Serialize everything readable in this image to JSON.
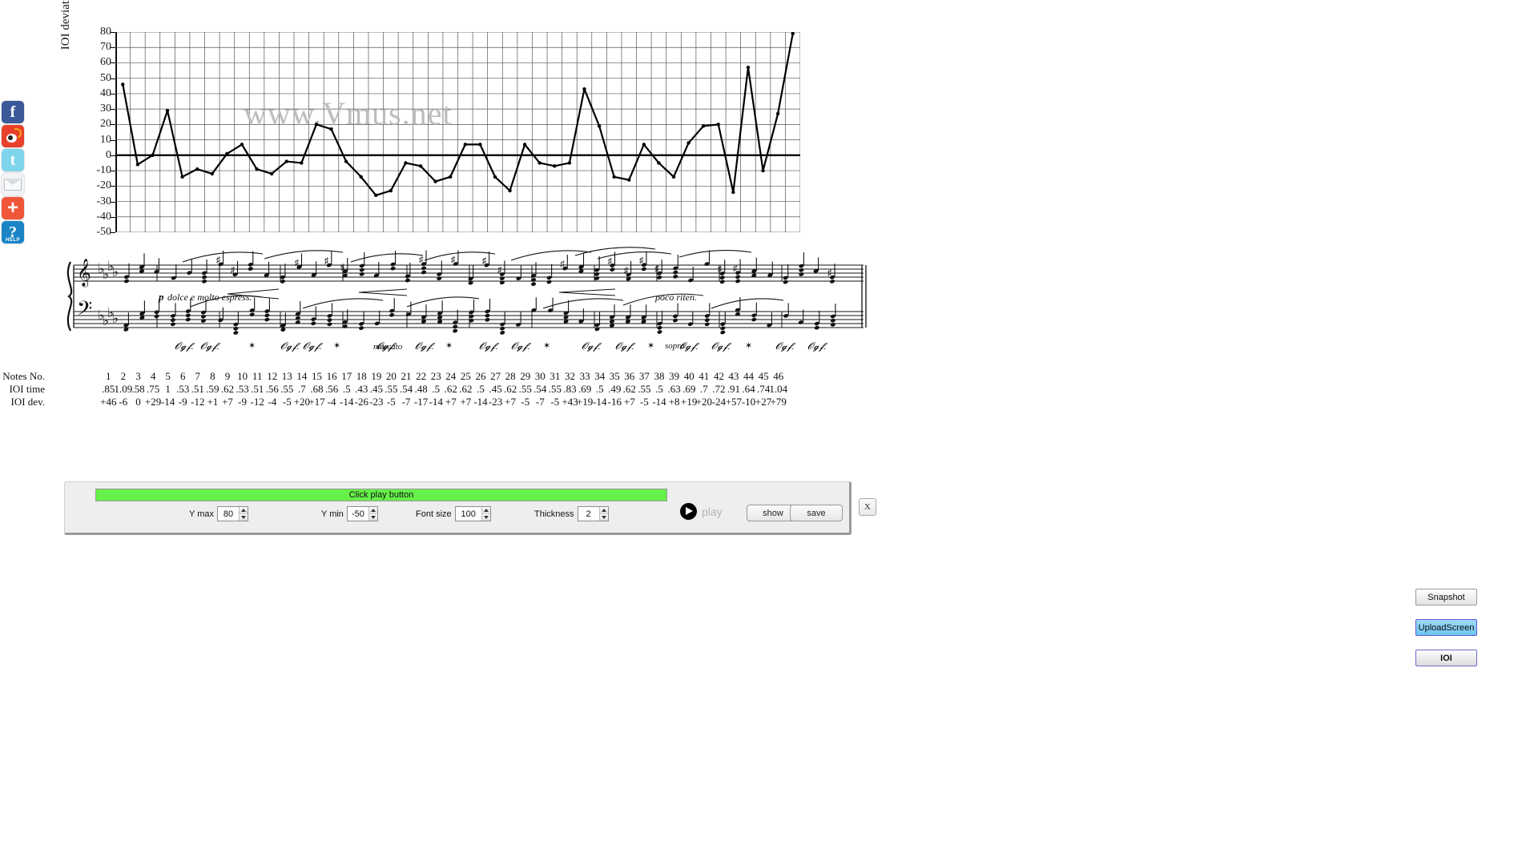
{
  "social_rail": {
    "items": [
      {
        "name": "facebook-icon",
        "label": "f",
        "color": "#3b5998"
      },
      {
        "name": "weibo-icon",
        "label": "",
        "color": "#e8402a"
      },
      {
        "name": "twitter-icon",
        "label": "t",
        "color": "#7ed4ea"
      },
      {
        "name": "email-icon",
        "label": "",
        "color": "#f2f3f5"
      },
      {
        "name": "share-plus-icon",
        "label": "+",
        "color": "#f0563a"
      },
      {
        "name": "help-icon",
        "label": "?",
        "sublabel": "HELP",
        "color": "#1a84c6"
      }
    ]
  },
  "watermark": "www.Vmus.net",
  "chart_data": {
    "type": "line",
    "title": "",
    "xlabel": "",
    "ylabel": "IOI deviations (%)",
    "ylim": [
      -50,
      80
    ],
    "ytick_step": 10,
    "yticks": [
      80,
      70,
      60,
      50,
      40,
      30,
      20,
      10,
      0,
      -10,
      -20,
      -30,
      -40,
      -50
    ],
    "grid": true,
    "legend": "none",
    "zero_line": 0,
    "x": [
      1,
      2,
      3,
      4,
      5,
      6,
      7,
      8,
      9,
      10,
      11,
      12,
      13,
      14,
      15,
      16,
      17,
      18,
      19,
      20,
      21,
      22,
      23,
      24,
      25,
      26,
      27,
      28,
      29,
      30,
      31,
      32,
      33,
      34,
      35,
      36,
      37,
      38,
      39,
      40,
      41,
      42,
      43,
      44,
      45,
      46
    ],
    "values": [
      46,
      -6,
      0,
      29,
      -14,
      -9,
      -12,
      1,
      7,
      -9,
      -12,
      -4,
      -5,
      20,
      17,
      -4,
      -14,
      -26,
      -23,
      -5,
      -7,
      -17,
      -14,
      7,
      7,
      -14,
      -23,
      7,
      -5,
      -7,
      -5,
      43,
      19,
      -14,
      -16,
      7,
      -5,
      -14,
      8,
      19,
      20,
      -24,
      57,
      -10,
      27,
      79
    ]
  },
  "table": {
    "rows": [
      {
        "label": "Notes No.",
        "values": [
          "1",
          "2",
          "3",
          "4",
          "5",
          "6",
          "7",
          "8",
          "9",
          "10",
          "11",
          "12",
          "13",
          "14",
          "15",
          "16",
          "17",
          "18",
          "19",
          "20",
          "21",
          "22",
          "23",
          "24",
          "25",
          "26",
          "27",
          "28",
          "29",
          "30",
          "31",
          "32",
          "33",
          "34",
          "35",
          "36",
          "37",
          "38",
          "39",
          "40",
          "41",
          "42",
          "43",
          "44",
          "45",
          "46"
        ]
      },
      {
        "label": "IOI time",
        "values": [
          ".85",
          "1.09",
          ".58",
          ".75",
          "1",
          ".53",
          ".51",
          ".59",
          ".62",
          ".53",
          ".51",
          ".56",
          ".55",
          ".7",
          ".68",
          ".56",
          ".5",
          ".43",
          ".45",
          ".55",
          ".54",
          ".48",
          ".5",
          ".62",
          ".62",
          ".5",
          ".45",
          ".62",
          ".55",
          ".54",
          ".55",
          ".83",
          ".69",
          ".5",
          ".49",
          ".62",
          ".55",
          ".5",
          ".63",
          ".69",
          ".7",
          ".72",
          ".91",
          ".64",
          ".74",
          "1.04"
        ]
      },
      {
        "label": "IOI dev.",
        "values": [
          "+46",
          "-6",
          "0",
          "+29",
          "-14",
          "-9",
          "-12",
          "+1",
          "+7",
          "-9",
          "-12",
          "-4",
          "-5",
          "+20",
          "+17",
          "-4",
          "-14",
          "-26",
          "-23",
          "-5",
          "-7",
          "-17",
          "-14",
          "+7",
          "+7",
          "-14",
          "-23",
          "+7",
          "-5",
          "-7",
          "-5",
          "+43",
          "+19",
          "-14",
          "-16",
          "+7",
          "-5",
          "-14",
          "+8",
          "+19",
          "+20",
          "-24",
          "+57",
          "-10",
          "+27",
          "+79"
        ]
      }
    ]
  },
  "score": {
    "markings": [
      "p",
      "dolce e molto  espress.",
      "marcato",
      "poco riten.",
      "sopra"
    ]
  },
  "player": {
    "progress_text": "Click play button",
    "progress_color": "#66f049",
    "play_label": "play",
    "show_label": "show",
    "save_label": "save",
    "close_label": "X",
    "controls": [
      {
        "name": "y-max",
        "label": "Y max",
        "value": "80"
      },
      {
        "name": "y-min",
        "label": "Y min",
        "value": "-50"
      },
      {
        "name": "font-size",
        "label": "Font size",
        "value": "100"
      },
      {
        "name": "thickness",
        "label": "Thickness",
        "value": "2"
      }
    ]
  },
  "right_buttons": {
    "snapshot": "Snapshot",
    "upload_screen": "UploadScreen",
    "ioi": "IOI"
  }
}
